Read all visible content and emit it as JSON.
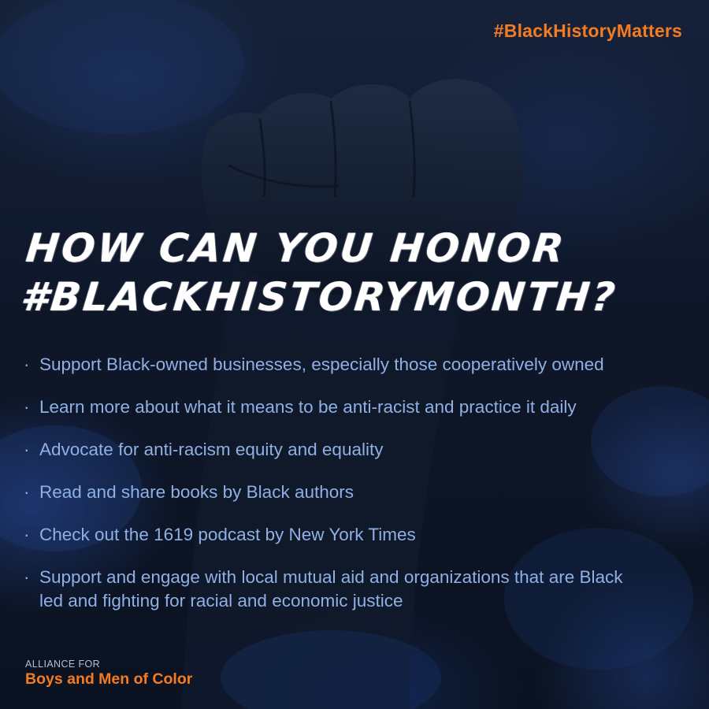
{
  "hashtag": "#BlackHistoryMatters",
  "headline": {
    "line1": "How Can You Honor",
    "line2": "#BlackHistoryMonth?"
  },
  "bullets": [
    {
      "text": "Support Black-owned businesses, especially those cooperatively owned"
    },
    {
      "text": "Learn more about what it means to be anti-racist and practice it daily"
    },
    {
      "text": "Advocate for anti-racism equity and equality"
    },
    {
      "text": "Read and share books by Black authors"
    },
    {
      "text": "Check out the 1619 podcast by New York Times"
    },
    {
      "text": "Support and engage with local mutual aid and organizations that are Black led and fighting for racial and economic justice"
    }
  ],
  "logo": {
    "top": "ALLIANCE FOR",
    "main": "Boys and Men of Color"
  },
  "colors": {
    "accent": "#f47b20",
    "bullet_text": "#8fb0e4",
    "headline": "#ffffff",
    "background": "#0e1628"
  },
  "icons": {
    "background_image": "raised-fist-icon"
  }
}
